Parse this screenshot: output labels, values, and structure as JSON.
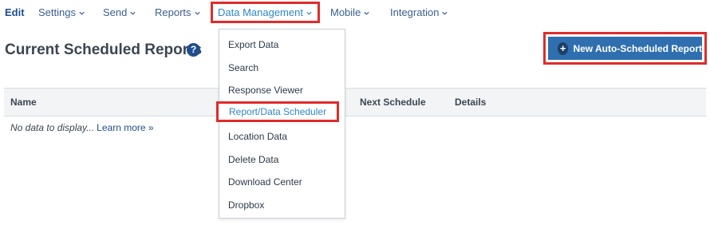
{
  "nav": {
    "edit": "Edit",
    "settings": "Settings",
    "send": "Send",
    "reports": "Reports",
    "data_management": "Data Management",
    "mobile": "Mobile",
    "integration": "Integration"
  },
  "page": {
    "title": "Current Scheduled Reports",
    "help_icon": "?"
  },
  "new_report_button": {
    "icon": "+",
    "label": "New Auto-Scheduled Report"
  },
  "table": {
    "columns": [
      "Name",
      "Next Schedule",
      "Details"
    ],
    "empty_text": "No data to display...",
    "learn_more": "Learn more »"
  },
  "dropdown": {
    "items": [
      "Export Data",
      "Search",
      "Response Viewer",
      "Report/Data Scheduler",
      "Location Data",
      "Delete Data",
      "Download Center",
      "Dropbox"
    ],
    "highlighted_index": 3
  },
  "colors": {
    "highlight_border": "#e02b2b",
    "accent_blue": "#2f6fb0",
    "link_blue": "#1f4e8c"
  }
}
